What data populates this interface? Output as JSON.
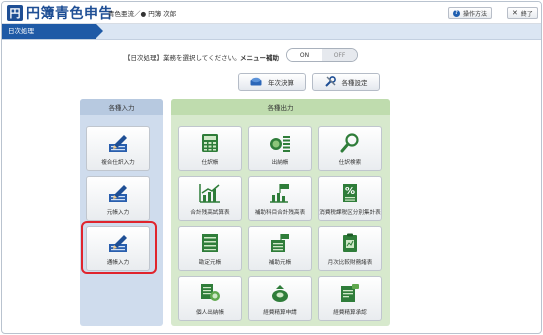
{
  "app": {
    "logo_mark": "円",
    "title": "円簿青色申告",
    "user": "青色亜流／● 円簿 次郎"
  },
  "header_buttons": {
    "help": "操作方法",
    "close": "終了"
  },
  "breadcrumb": "日次処理",
  "instruction": "【日次処理】業務を選択してください。",
  "menu_help": {
    "label": "メニュー補助",
    "on": "ON",
    "off": "OFF"
  },
  "utility_buttons": {
    "annual": "年次決算",
    "settings": "各種設定"
  },
  "panels": {
    "input_title": "各種入力",
    "output_title": "各種出力"
  },
  "input_tiles": [
    {
      "label": "複合仕訳入力",
      "icon": "pen-form-icon"
    },
    {
      "label": "元帳入力",
      "icon": "pen-form-icon"
    },
    {
      "label": "通帳入力",
      "icon": "pen-form-icon"
    }
  ],
  "output_tiles": [
    {
      "label": "仕訳帳",
      "icon": "calculator-icon"
    },
    {
      "label": "出納帳",
      "icon": "coins-icon"
    },
    {
      "label": "仕訳検索",
      "icon": "magnifier-icon"
    },
    {
      "label": "合計残高試算表",
      "icon": "bar-chart-icon"
    },
    {
      "label": "補助科目合計残高表",
      "icon": "flag-chart-icon"
    },
    {
      "label": "消費税課税区分別集計表",
      "icon": "percent-doc-icon"
    },
    {
      "label": "勘定元帳",
      "icon": "ledger-icon"
    },
    {
      "label": "補助元帳",
      "icon": "flag-ledger-icon"
    },
    {
      "label": "月次比較財務諸表",
      "icon": "clipboard-icon"
    },
    {
      "label": "個人出納帳",
      "icon": "person-coins-icon"
    },
    {
      "label": "経費精算申請",
      "icon": "money-bag-icon"
    },
    {
      "label": "経費精算承認",
      "icon": "approve-doc-icon"
    }
  ],
  "colors": {
    "brand": "#1f4f95",
    "highlight": "#e0242d",
    "input_panel": "#cfdced",
    "output_panel": "#d7e9cd"
  }
}
